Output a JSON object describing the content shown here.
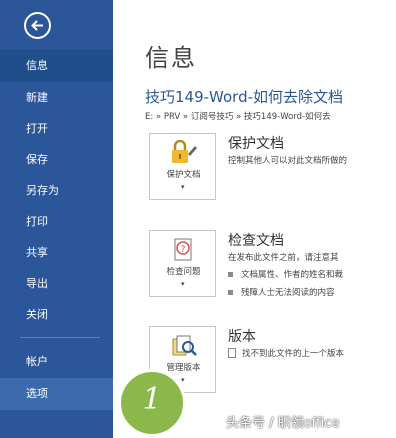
{
  "sidebar": {
    "items": [
      {
        "label": "信息"
      },
      {
        "label": "新建"
      },
      {
        "label": "打开"
      },
      {
        "label": "保存"
      },
      {
        "label": "另存为"
      },
      {
        "label": "打印"
      },
      {
        "label": "共享"
      },
      {
        "label": "导出"
      },
      {
        "label": "关闭"
      },
      {
        "label": "帐户"
      },
      {
        "label": "选项"
      }
    ]
  },
  "main": {
    "title": "信息",
    "doc_title": "技巧149-Word-如何去除文档",
    "doc_path": "E: » PRV » 订阅号技巧 » 技巧149-Word-如何去",
    "protect": {
      "button_label": "保护文档",
      "title": "保护文档",
      "desc": "控制其他人可以对此文档所做的"
    },
    "inspect": {
      "button_label": "检查问题",
      "title": "检查文档",
      "desc": "在发布此文件之前，请注意其",
      "bullets": [
        "文档属性、作者的姓名和裁",
        "残障人士无法阅读的内容"
      ]
    },
    "version": {
      "button_label": "管理版本",
      "title": "版本",
      "desc": "找不到此文件的上一个版本"
    }
  },
  "marker": {
    "number": "1",
    "color": "#8ab84b"
  },
  "watermark": "头条号 / 职领office",
  "colors": {
    "sidebar": "#2b579a",
    "accent": "#2b579a"
  }
}
